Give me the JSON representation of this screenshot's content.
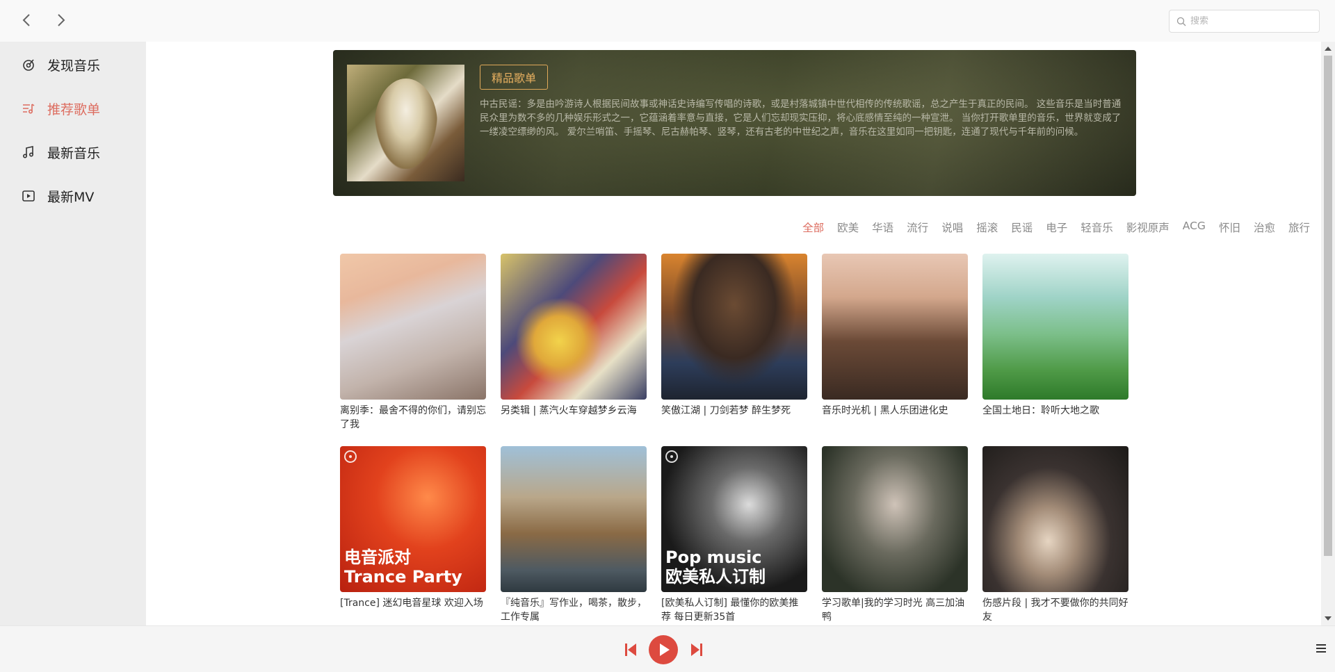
{
  "header": {
    "back_icon": "chevron-left-icon",
    "forward_icon": "chevron-right-icon",
    "search": {
      "placeholder": "搜索",
      "value": ""
    }
  },
  "sidebar": {
    "items": [
      {
        "label": "发现音乐",
        "icon": "discover-icon",
        "active": false
      },
      {
        "label": "推荐歌单",
        "icon": "playlist-icon",
        "active": true
      },
      {
        "label": "最新音乐",
        "icon": "music-note-icon",
        "active": false
      },
      {
        "label": "最新MV",
        "icon": "video-icon",
        "active": false
      }
    ]
  },
  "banner": {
    "tag": "精品歌单",
    "description": "中古民谣：多是由吟游诗人根据民间故事或神话史诗编写传唱的诗歌，或是村落城镇中世代相传的传统歌谣，总之产生于真正的民间。 这些音乐是当时普通民众里为数不多的几种娱乐形式之一，它蕴涵着率意与直接，它是人们忘却现实压抑，将心底感情至纯的一种宣泄。 当你打开歌单里的音乐，世界就变成了一缕凌空缥缈的风。 爱尔兰哨笛、手摇琴、尼古赫帕琴、竖琴，还有古老的中世纪之声，音乐在这里如同一把钥匙，连通了现代与千年前的问候。"
  },
  "categories": [
    "全部",
    "欧美",
    "华语",
    "流行",
    "说唱",
    "摇滚",
    "民谣",
    "电子",
    "轻音乐",
    "影视原声",
    "ACG",
    "怀旧",
    "治愈",
    "旅行"
  ],
  "active_category": "全部",
  "playlists": [
    {
      "title": "离别季：最舍不得的你们，请别忘了我",
      "cover_text": "",
      "badge": false
    },
    {
      "title": "另类辑 | 蒸汽火车穿越梦乡云海",
      "cover_text": "",
      "badge": false
    },
    {
      "title": "笑傲江湖 | 刀剑若梦 醉生梦死",
      "cover_text": "",
      "badge": false
    },
    {
      "title": "音乐时光机 | 黑人乐团进化史",
      "cover_text": "",
      "badge": false
    },
    {
      "title": "全国土地日：聆听大地之歌",
      "cover_text": "",
      "badge": false
    },
    {
      "title": "[Trance] 迷幻电音星球 欢迎入场",
      "cover_text": "电音派对\nTrance Party",
      "badge": true
    },
    {
      "title": "『纯音乐』写作业，喝茶，散步，工作专属",
      "cover_text": "",
      "badge": false
    },
    {
      "title": "[欧美私人订制] 最懂你的欧美推荐 每日更新35首",
      "cover_text": "Pop music\n欧美私人订制",
      "badge": true
    },
    {
      "title": "学习歌单|我的学习时光 高三加油鸭",
      "cover_text": "",
      "badge": false
    },
    {
      "title": "伤感片段 | 我才不要做你的共同好友",
      "cover_text": "",
      "badge": false
    }
  ],
  "player": {
    "prev_icon": "skip-previous-icon",
    "play_icon": "play-icon",
    "next_icon": "skip-next-icon",
    "menu_icon": "playlist-menu-icon",
    "accent": "#dd4a3f"
  },
  "colors": {
    "accent": "#dd6d60",
    "sidebar_bg": "#ededed"
  }
}
